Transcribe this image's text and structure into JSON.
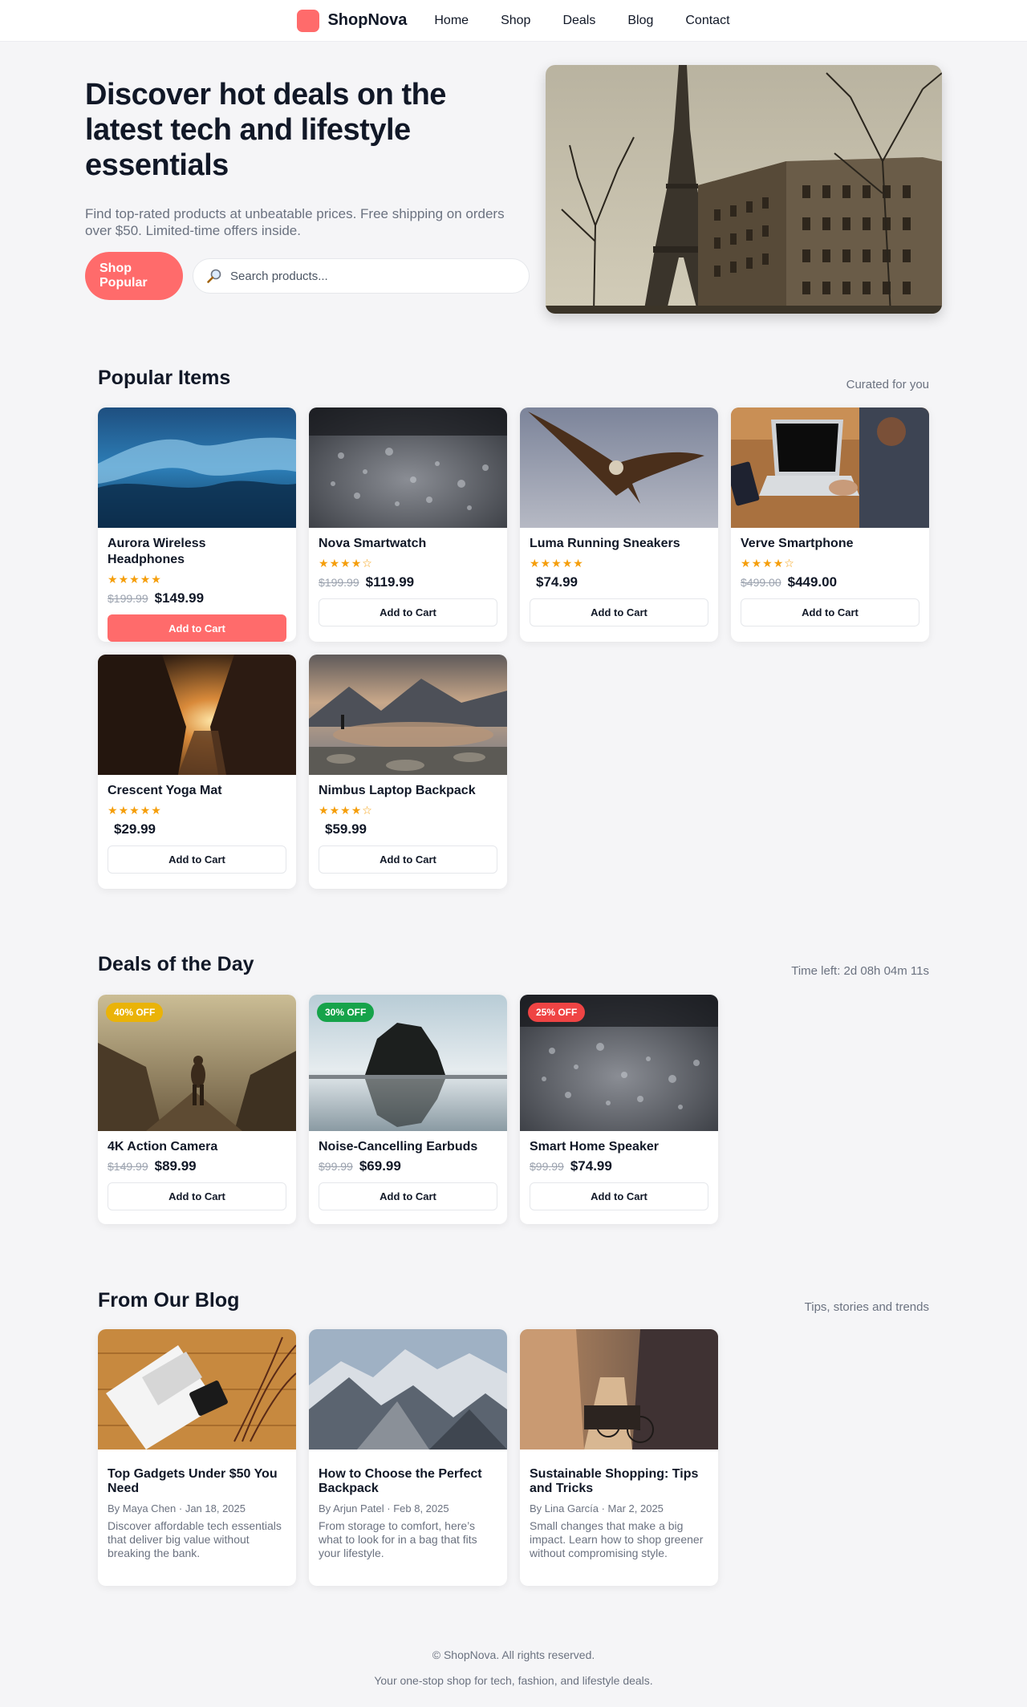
{
  "nav": {
    "brand": "ShopNova",
    "links": [
      "Home",
      "Shop",
      "Deals",
      "Blog",
      "Contact"
    ]
  },
  "hero": {
    "title": "Discover hot deals on the latest tech and lifestyle essentials",
    "subtitle": "Find top-rated products at unbeatable prices. Free shipping on orders over $50. Limited-time offers inside.",
    "cta_label": "Shop Popular",
    "search_placeholder": "Search products..."
  },
  "popular": {
    "title": "Popular Items",
    "aside": "Curated for you",
    "items": [
      {
        "name": "Aurora Wireless Headphones",
        "rating": 5,
        "old_price": "$199.99",
        "price": "$149.99",
        "button": "Add to Cart",
        "image": "ocean-wave"
      },
      {
        "name": "Nova Smartwatch",
        "rating": 4,
        "old_price": "$199.99",
        "price": "$119.99",
        "button": "Add to Cart",
        "image": "water-droplets"
      },
      {
        "name": "Luma Running Sneakers",
        "rating": 5,
        "old_price": "",
        "price": "$74.99",
        "button": "Add to Cart",
        "image": "eagle"
      },
      {
        "name": "Verve Smartphone",
        "rating": 4,
        "old_price": "$499.00",
        "price": "$449.00",
        "button": "Add to Cart",
        "image": "laptop-desk"
      },
      {
        "name": "Crescent Yoga Mat",
        "rating": 5,
        "old_price": "",
        "price": "$29.99",
        "button": "Add to Cart",
        "image": "city-sunset"
      },
      {
        "name": "Nimbus Laptop Backpack",
        "rating": 4,
        "old_price": "",
        "price": "$59.99",
        "button": "Add to Cart",
        "image": "mountain-lake"
      }
    ]
  },
  "deals": {
    "title": "Deals of the Day",
    "aside": "Time left: 2d 08h 04m 11s",
    "items": [
      {
        "badge": "40% OFF",
        "badge_color": "#eab308",
        "name": "4K Action Camera",
        "old_price": "$149.99",
        "price": "$89.99",
        "button": "Add to Cart",
        "image": "hiker"
      },
      {
        "badge": "30% OFF",
        "badge_color": "#16a34a",
        "name": "Noise-Cancelling Earbuds",
        "old_price": "$99.99",
        "price": "$69.99",
        "button": "Add to Cart",
        "image": "sea-rock"
      },
      {
        "badge": "25% OFF",
        "badge_color": "#ef4444",
        "name": "Smart Home Speaker",
        "old_price": "$99.99",
        "price": "$74.99",
        "button": "Add to Cart",
        "image": "water-droplets"
      }
    ]
  },
  "blog": {
    "title": "From Our Blog",
    "aside": "Tips, stories and trends",
    "posts": [
      {
        "title": "Top Gadgets Under $50 You Need",
        "meta": "By Maya Chen · Jan 18, 2025",
        "excerpt": "Discover affordable tech essentials that deliver big value without breaking the bank.",
        "image": "magazine-desk"
      },
      {
        "title": "How to Choose the Perfect Backpack",
        "meta": "By Arjun Patel · Feb 8, 2025",
        "excerpt": "From storage to comfort, here’s what to look for in a bag that fits your lifestyle.",
        "image": "snowy-mountains"
      },
      {
        "title": "Sustainable Shopping: Tips and Tricks",
        "meta": "By Lina García · Mar 2, 2025",
        "excerpt": "Small changes that make a big impact. Learn how to shop greener without compromising style.",
        "image": "street-bikes"
      }
    ]
  },
  "footer": {
    "copyright": "© ShopNova. All rights reserved.",
    "tagline": "Your one-stop shop for tech, fashion, and lifestyle deals."
  },
  "colors": {
    "accent": "#ff6b6b",
    "star": "#f59e0b"
  }
}
